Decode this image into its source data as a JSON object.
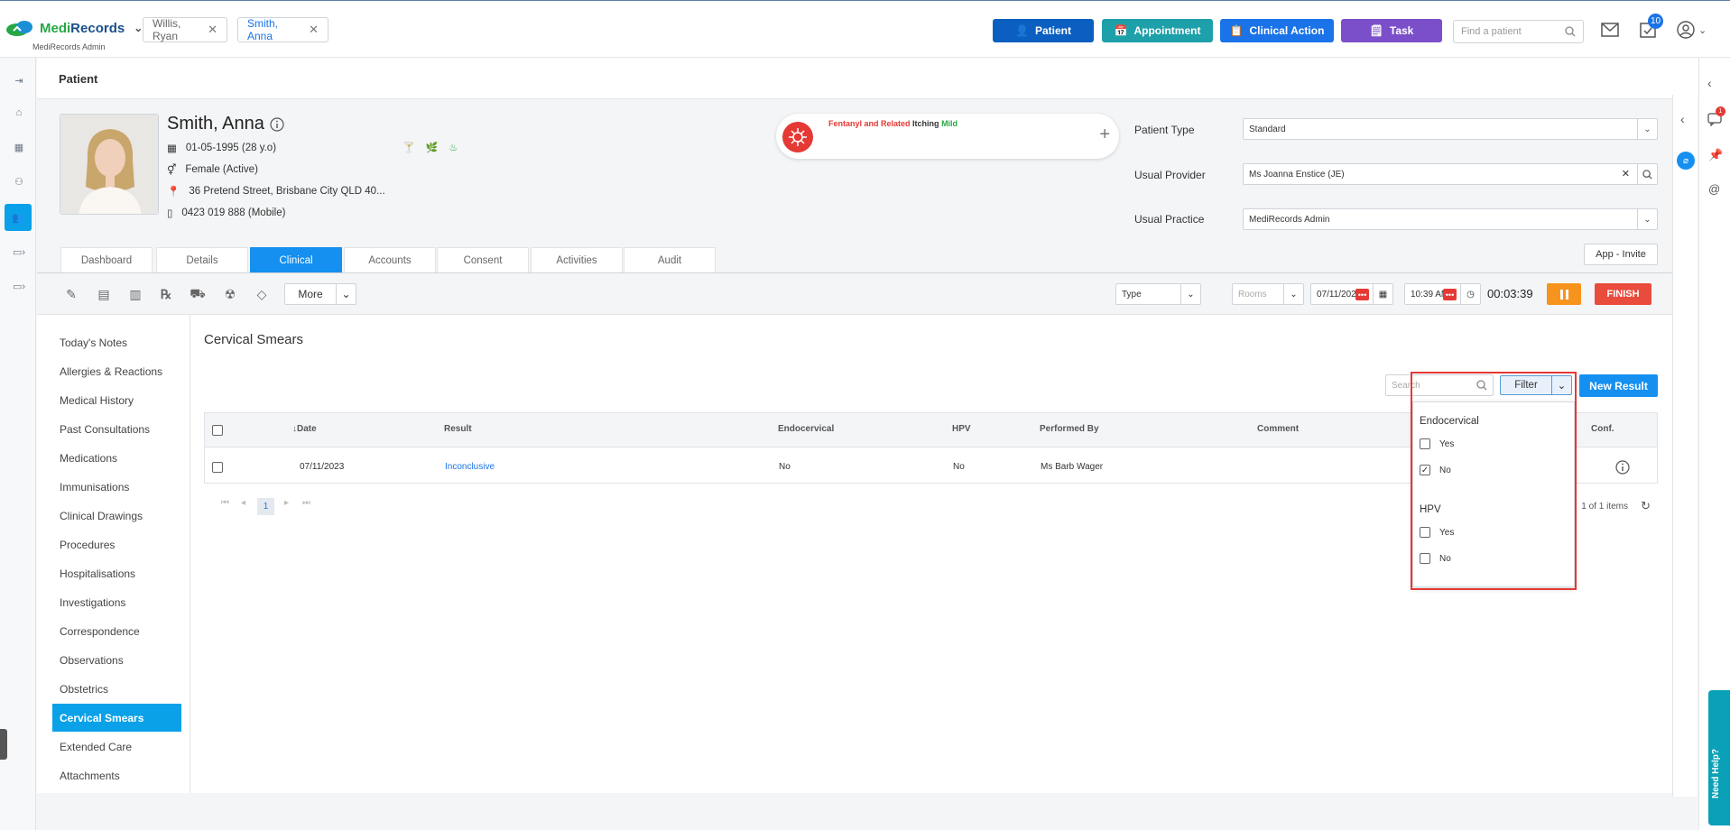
{
  "app": {
    "brand_medi": "Medi",
    "brand_records": "Records",
    "brand_sub": "MediRecords Admin"
  },
  "patient_tabs": [
    {
      "label": "Willis, Ryan"
    },
    {
      "label": "Smith, Anna"
    }
  ],
  "quick_actions": {
    "patient": "Patient",
    "appointment": "Appointment",
    "clinical_action": "Clinical Action",
    "task": "Task"
  },
  "search": {
    "find_patient_placeholder": "Find a patient"
  },
  "notifications": {
    "tasks_count": "10",
    "sidebar_count": "1"
  },
  "page": {
    "title": "Patient"
  },
  "patient": {
    "name": "Smith, Anna",
    "dob": "01-05-1995 (28 y.o)",
    "gender": "Female (Active)",
    "address": "36 Pretend Street, Brisbane City QLD 40...",
    "phone": "0423 019 888 (Mobile)"
  },
  "allergy": {
    "substance": "Fentanyl and Related",
    "reaction": "Itching",
    "severity": "Mild"
  },
  "fields": {
    "patient_type_label": "Patient Type",
    "patient_type_value": "Standard",
    "usual_provider_label": "Usual Provider",
    "usual_provider_value": "Ms Joanna Enstice (JE)",
    "usual_practice_label": "Usual Practice",
    "usual_practice_value": "MediRecords Admin"
  },
  "app_invite": "App - Invite",
  "tabs": [
    "Dashboard",
    "Details",
    "Clinical",
    "Accounts",
    "Consent",
    "Activities",
    "Audit"
  ],
  "toolbar": {
    "more": "More",
    "type_placeholder": "Type",
    "rooms_placeholder": "Rooms",
    "date_value": "07/11/2023",
    "time_value": "10:39 AM",
    "timer": "00:03:39",
    "finish": "FINISH"
  },
  "side_menu": [
    "Today's Notes",
    "Allergies & Reactions",
    "Medical History",
    "Past Consultations",
    "Medications",
    "Immunisations",
    "Clinical Drawings",
    "Procedures",
    "Hospitalisations",
    "Investigations",
    "Correspondence",
    "Observations",
    "Obstetrics",
    "Cervical Smears",
    "Extended Care",
    "Attachments"
  ],
  "content": {
    "title": "Cervical Smears",
    "search_placeholder": "Search",
    "filter": "Filter",
    "new_result": "New Result",
    "columns": {
      "date": "Date",
      "result": "Result",
      "endocervical": "Endocervical",
      "hpv": "HPV",
      "performed_by": "Performed By",
      "comment": "Comment",
      "conf": "Conf."
    },
    "rows": [
      {
        "date": "07/11/2023",
        "result": "Inconclusive",
        "endocervical": "No",
        "hpv": "No",
        "performed_by": "Ms Barb Wager",
        "comment": ""
      }
    ],
    "page": "1",
    "items_text": "1 of 1 items"
  },
  "filter_dropdown": {
    "endocervical_label": "Endocervical",
    "hpv_label": "HPV",
    "yes": "Yes",
    "no": "No",
    "endocervical_no_checked": true
  },
  "colors": {
    "primary": "#1590f0",
    "patient_btn": "#0a5fc0",
    "appointment_btn": "#1ea0aa",
    "clinical_btn": "#1a73e8",
    "task_btn": "#7b4fc9",
    "finish": "#e94b3c",
    "pause": "#f7941d",
    "highlight": "#e53935"
  },
  "help_tab": "Need Help?"
}
